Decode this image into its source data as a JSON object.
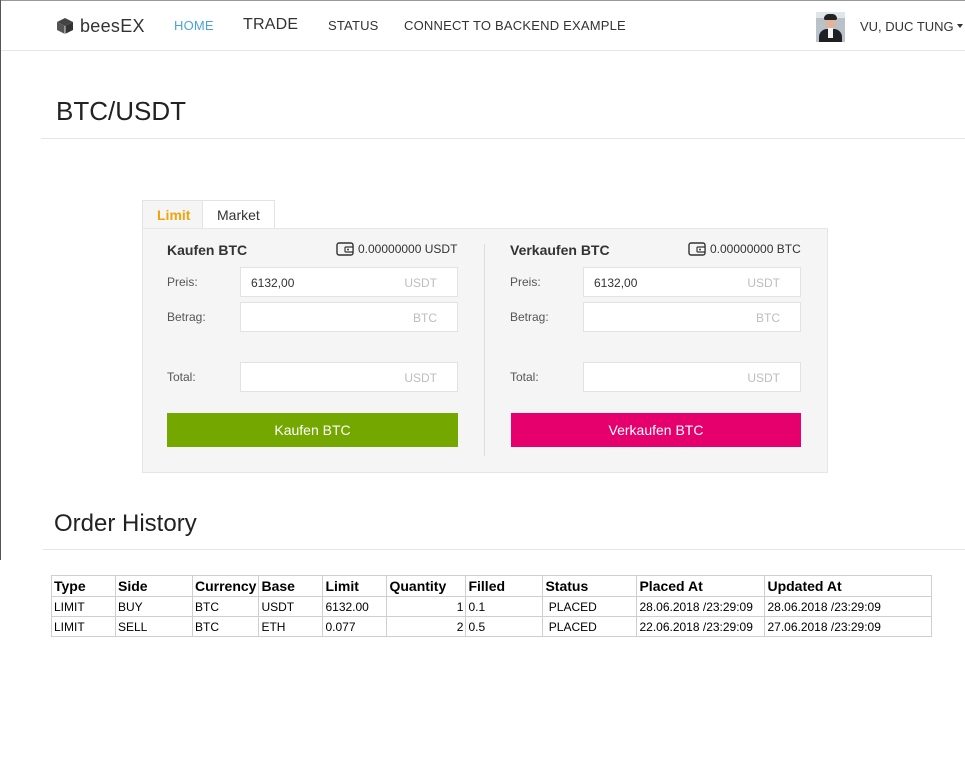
{
  "nav": {
    "brand": "beesEX",
    "links": {
      "home": "HOME",
      "trade": "TRADE",
      "status": "STATUS",
      "backend": "CONNECT TO BACKEND EXAMPLE"
    },
    "user": "VU, DUC TUNG",
    "active_color": "#4aa3df"
  },
  "page": {
    "title": "BTC/USDT"
  },
  "trade": {
    "tabs": {
      "limit": "Limit",
      "market": "Market"
    },
    "buy": {
      "title": "Kaufen BTC",
      "balance": "0.00000000 USDT",
      "price_label": "Preis:",
      "price_value": "6132,00",
      "price_unit": "USDT",
      "amount_label": "Betrag:",
      "amount_unit": "BTC",
      "total_label": "Total:",
      "total_unit": "USDT",
      "button": "Kaufen BTC",
      "color": "#74a800"
    },
    "sell": {
      "title": "Verkaufen BTC",
      "balance": "0.00000000 BTC",
      "price_label": "Preis:",
      "price_value": "6132,00",
      "price_unit": "USDT",
      "amount_label": "Betrag:",
      "amount_unit": "BTC",
      "total_label": "Total:",
      "total_unit": "USDT",
      "button": "Verkaufen BTC",
      "color": "#e6006e"
    }
  },
  "history": {
    "title": "Order History",
    "columns": [
      "Type",
      "Side",
      "Currency",
      "Base",
      "Limit",
      "Quantity",
      "Filled",
      "Status",
      "Placed At",
      "Updated At"
    ],
    "rows": [
      [
        "LIMIT",
        "BUY",
        "BTC",
        "USDT",
        "6132.00",
        "1",
        "0.1",
        " PLACED",
        "28.06.2018 /23:29:09",
        "28.06.2018 /23:29:09"
      ],
      [
        "LIMIT",
        "SELL",
        "BTC",
        "ETH",
        "0.077",
        "2",
        "0.5",
        " PLACED",
        "22.06.2018 /23:29:09",
        "27.06.2018 /23:29:09"
      ]
    ]
  }
}
